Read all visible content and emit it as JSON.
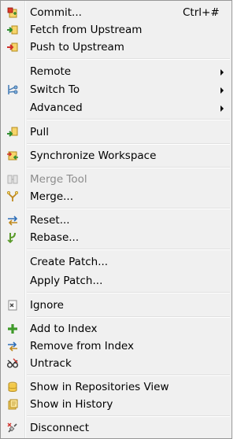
{
  "menu": {
    "items": [
      {
        "label": "Commit...",
        "shortcut": "Ctrl+#",
        "icon": "commit-icon"
      },
      {
        "label": "Fetch from Upstream",
        "icon": "fetch-icon"
      },
      {
        "label": "Push to Upstream",
        "icon": "push-icon"
      },
      {
        "label": "Remote",
        "submenu": true
      },
      {
        "label": "Switch To",
        "submenu": true,
        "icon": "switch-branch-icon"
      },
      {
        "label": "Advanced",
        "submenu": true
      },
      {
        "label": "Pull",
        "icon": "pull-icon"
      },
      {
        "label": "Synchronize Workspace",
        "icon": "synchronize-icon"
      },
      {
        "label": "Merge Tool",
        "disabled": true,
        "icon": "merge-tool-icon"
      },
      {
        "label": "Merge...",
        "icon": "merge-icon"
      },
      {
        "label": "Reset...",
        "icon": "reset-icon"
      },
      {
        "label": "Rebase...",
        "icon": "rebase-icon"
      },
      {
        "label": "Create Patch..."
      },
      {
        "label": "Apply Patch..."
      },
      {
        "label": "Ignore",
        "icon": "ignore-icon"
      },
      {
        "label": "Add to Index",
        "icon": "add-icon"
      },
      {
        "label": "Remove from Index",
        "icon": "remove-from-index-icon"
      },
      {
        "label": "Untrack",
        "icon": "untrack-icon"
      },
      {
        "label": "Show in Repositories View",
        "icon": "repositories-view-icon"
      },
      {
        "label": "Show in History",
        "icon": "history-icon"
      },
      {
        "label": "Disconnect",
        "icon": "disconnect-icon"
      }
    ]
  },
  "colors": {
    "menu_background": "#f0f0f0",
    "disabled_text": "#8d8d8d",
    "border": "#979797"
  }
}
